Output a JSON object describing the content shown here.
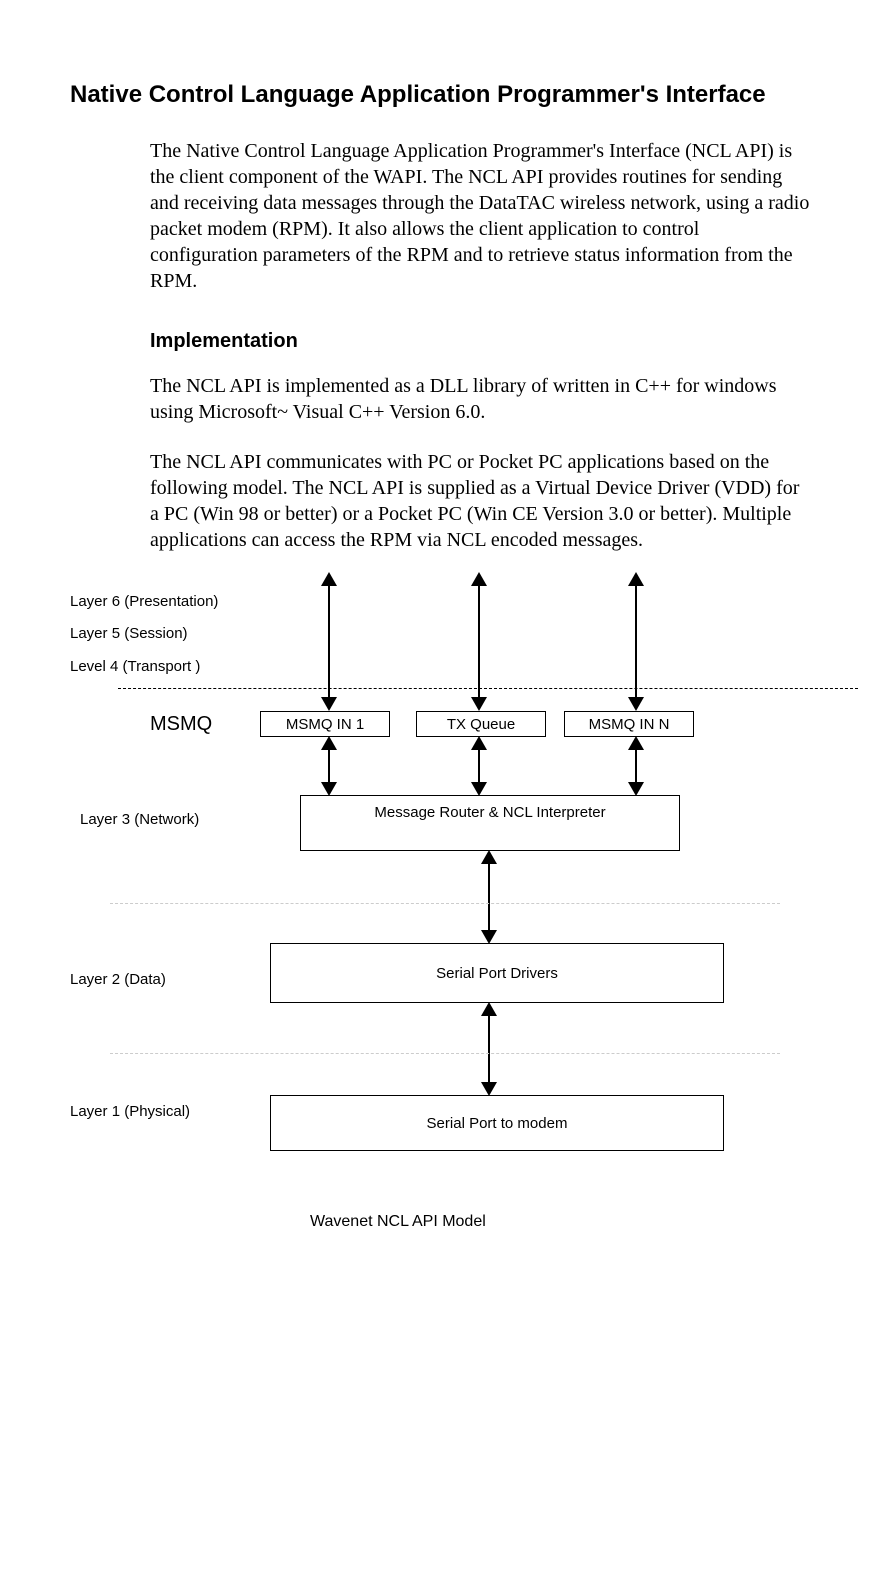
{
  "section_title": "Native Control Language Application Programmer's Interface",
  "para1": "The Native Control Language Application Programmer's Interface (NCL API) is the client component of the WAPI. The NCL API provides routines for sending and receiving data messages through the DataTAC wireless network, using a radio packet modem (RPM). It also allows the client application to control configuration parameters of the RPM and to retrieve status information from the RPM.",
  "sub_heading": "Implementation",
  "para2": "The NCL API is implemented as a DLL library of written in C++  for windows using Microsoft~ Visual C++ Version 6.0.",
  "para3": "The NCL API communicates with PC or Pocket PC applications based on the following model. The NCL API is supplied as a Virtual Device Driver (VDD) for a PC (Win 98 or better) or a Pocket PC (Win CE Version 3.0 or better). Multiple applications can access the RPM via NCL encoded messages.",
  "diagram": {
    "layer6": "Layer 6 (Presentation)",
    "layer5": "Layer 5 (Session)",
    "layer4": "Level 4 (Transport )",
    "msmq": "MSMQ",
    "q1": "MSMQ IN 1",
    "q2": "TX Queue",
    "q3": "MSMQ IN N",
    "layer3": "Layer 3  (Network)",
    "router_box": "Message Router & NCL Interpreter",
    "layer2": "Layer 2 (Data)",
    "serial_drivers": "Serial Port Drivers",
    "layer1": "Layer 1 (Physical)",
    "serial_port": "Serial Port  to modem",
    "caption": "Wavenet NCL API Model"
  }
}
